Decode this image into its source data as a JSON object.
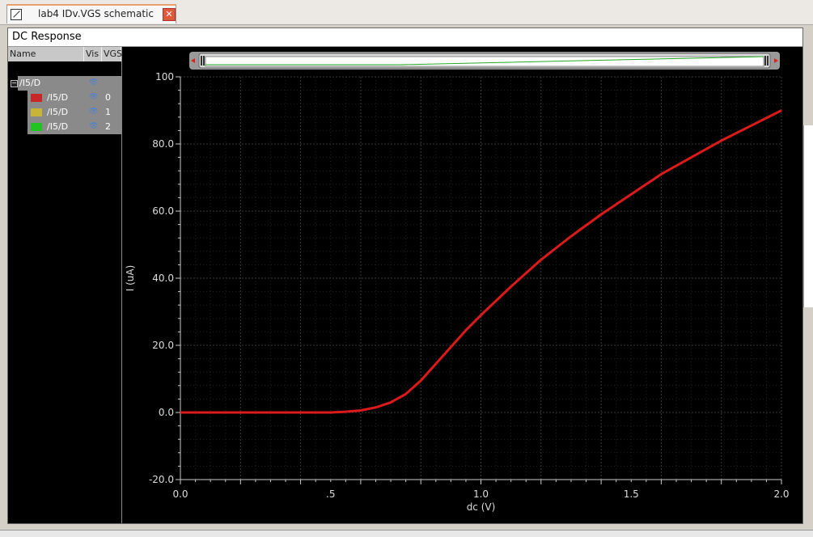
{
  "tab": {
    "title": "lab4 IDv.VGS schematic",
    "close_symbol": "✕"
  },
  "window": {
    "title": "DC Response"
  },
  "panel": {
    "columns": [
      "Name",
      "Vis",
      "VGS"
    ],
    "group": {
      "label": "/I5/D"
    },
    "traces": [
      {
        "label": "/I5/D",
        "color": "#c62828",
        "value": "0"
      },
      {
        "label": "/I5/D",
        "color": "#c8b43a",
        "value": "1"
      },
      {
        "label": "/I5/D",
        "color": "#22c422",
        "value": "2"
      }
    ]
  },
  "chart_data": {
    "type": "line",
    "xlabel": "dc (V)",
    "ylabel": "I (uA)",
    "xlim": [
      0.0,
      2.0
    ],
    "ylim": [
      -20.0,
      100.0
    ],
    "x_ticks": [
      "0.0",
      ".5",
      "1.0",
      "1.5",
      "2.0"
    ],
    "y_ticks": [
      "-20.0",
      "0.0",
      "20.0",
      "40.0",
      "60.0",
      "80.0",
      "100"
    ],
    "grid": true,
    "series": [
      {
        "color": "#dd1a1a",
        "x": [
          0.0,
          0.5,
          0.55,
          0.6,
          0.65,
          0.7,
          0.75,
          0.8,
          0.85,
          0.9,
          0.95,
          1.0,
          1.1,
          1.2,
          1.3,
          1.4,
          1.5,
          1.6,
          1.7,
          1.8,
          1.9,
          2.0
        ],
        "y": [
          0.0,
          0.0,
          0.2,
          0.6,
          1.5,
          3.0,
          5.5,
          9.5,
          14.5,
          19.5,
          24.5,
          29.0,
          37.5,
          45.5,
          52.5,
          59.0,
          65.0,
          71.0,
          76.0,
          81.0,
          85.5,
          90.0
        ]
      }
    ]
  }
}
